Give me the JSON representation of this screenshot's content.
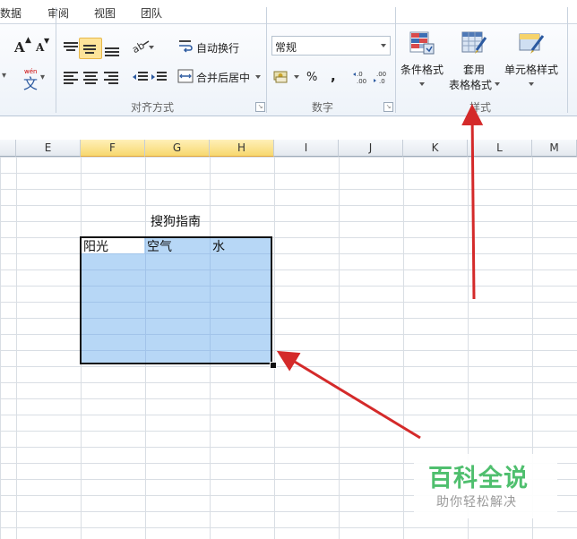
{
  "tabs": [
    "数据",
    "审阅",
    "视图",
    "团队"
  ],
  "alignment": {
    "wrap_label": "自动换行",
    "merge_label": "合并后居中",
    "group_label": "对齐方式"
  },
  "number": {
    "format_value": "常规",
    "percent": "%",
    "comma": ",",
    "group_label": "数字"
  },
  "styles": {
    "conditional_label": "条件格式",
    "table_label_1": "套用",
    "table_label_2": "表格格式",
    "cell_label": "单元格样式",
    "group_label": "样式"
  },
  "font": {
    "grow": "A",
    "shrink": "A",
    "wen": "文"
  },
  "columns": [
    "E",
    "F",
    "G",
    "H",
    "I",
    "J",
    "K",
    "L",
    "M"
  ],
  "sheet": {
    "title": "搜狗指南",
    "headers": [
      "阳光",
      "空气",
      "水"
    ]
  },
  "watermark": {
    "main": "百科全说",
    "sub": "助你轻松解决"
  },
  "colors": {
    "selection_fill": "#b7d7f6",
    "arrow": "#d42a2a",
    "watermark_green": "#4fbf6e",
    "selected_column_header": "#f7d86f"
  }
}
